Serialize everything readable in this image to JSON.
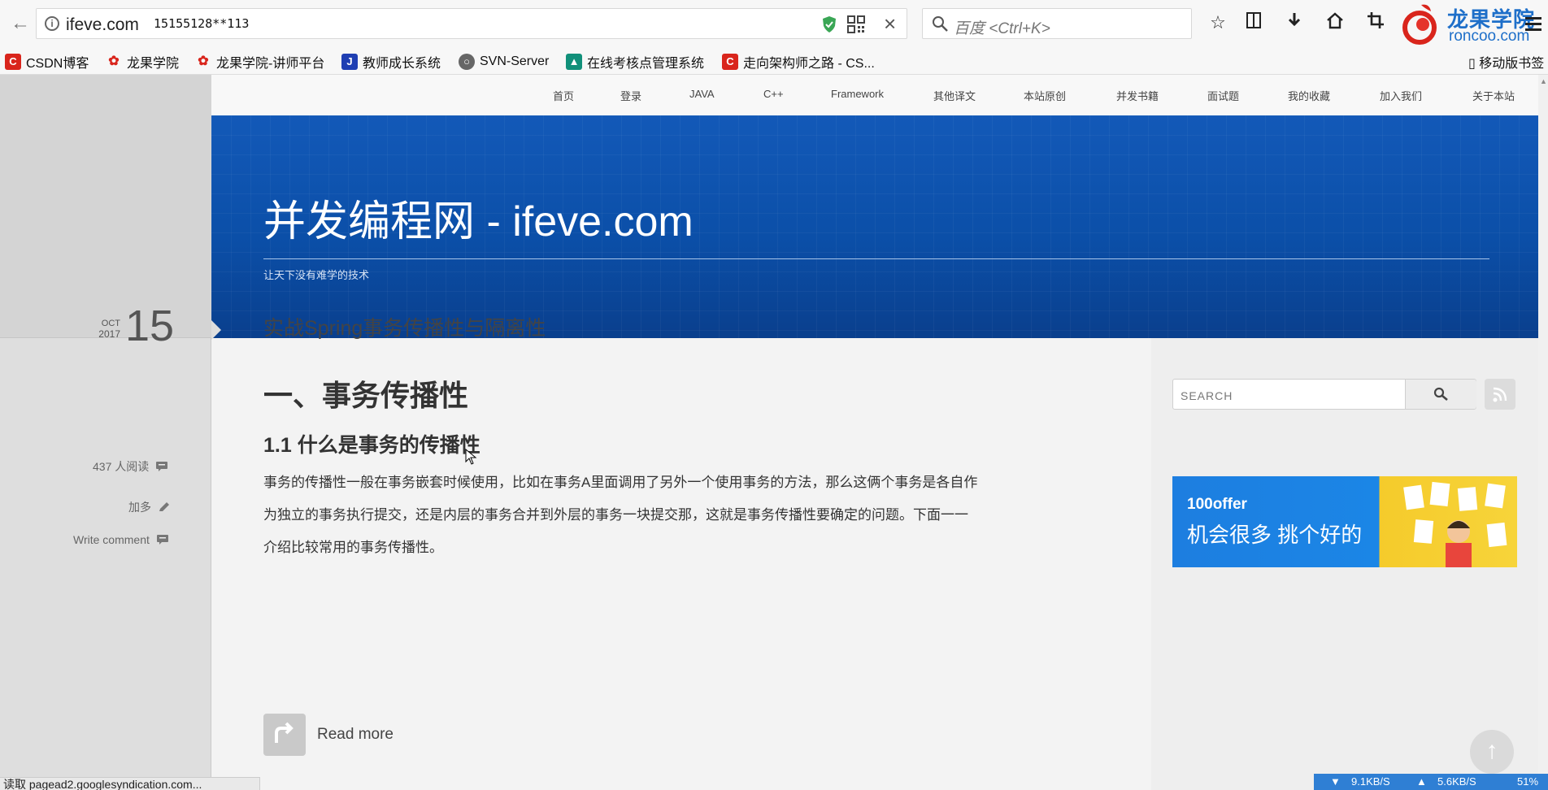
{
  "browser": {
    "url": "ifeve.com",
    "url_overlay": "15155128**113",
    "search_placeholder": "百度 <Ctrl+K>",
    "brand_name": "龙果学院",
    "brand_domain": "roncoo.com"
  },
  "bookmarks": {
    "items": [
      {
        "label": "CSDN博客",
        "icon": "csdn-icon",
        "color": "#d9251c"
      },
      {
        "label": "龙果学院",
        "icon": "roncoo-icon",
        "color": "#d9251c"
      },
      {
        "label": "龙果学院-讲师平台",
        "icon": "roncoo-icon",
        "color": "#d9251c"
      },
      {
        "label": "教师成长系统",
        "icon": "teacher-icon",
        "color": "#1f3fb3"
      },
      {
        "label": "SVN-Server",
        "icon": "globe-icon",
        "color": "#555555"
      },
      {
        "label": "在线考核点管理系统",
        "icon": "exam-icon",
        "color": "#11907a"
      },
      {
        "label": "走向架构师之路 - CS...",
        "icon": "csdn-icon",
        "color": "#d9251c"
      }
    ],
    "mobile_label": "移动版书签"
  },
  "nav": {
    "items": [
      "首页",
      "登录",
      "JAVA",
      "C++",
      "Framework",
      "其他译文",
      "本站原创",
      "并发书籍",
      "面试题",
      "我的收藏",
      "加入我们",
      "关于本站"
    ]
  },
  "site": {
    "title": "并发编程网 - ifeve.com",
    "tagline": "让天下没有难学的技术"
  },
  "post": {
    "month": "OCT",
    "year": "2017",
    "day": "15",
    "reads": "437 人阅读",
    "like": "加多",
    "comment": "Write comment",
    "title": "实战Spring事务传播性与隔离性",
    "h1": "一、事务传播性",
    "h2": "1.1 什么是事务的传播性",
    "paragraph": [
      "事务的传播性一般在事务嵌套时候使用，比如在事务A里面调用了另外一个使用事务的方法，那么这俩个事务是各自作",
      "为独立的事务执行提交，还是内层的事务合并到外层的事务一块提交那，这就是事务传播性要确定的问题。下面一一",
      "介绍比较常用的事务传播性。"
    ],
    "read_more": "Read more"
  },
  "sidebar": {
    "search_placeholder": "SEARCH",
    "ad_logo": "100offer",
    "ad_slogan": "机会很多 挑个好的"
  },
  "status": {
    "text": "读取 pagead2.googlesyndication.com...",
    "down": "9.1KB/S",
    "up": "5.6KB/S",
    "percent": "51%"
  },
  "colors": {
    "banner": "#0b4fa8",
    "brand": "#1e6fc9",
    "ad_blue": "#1b86e6",
    "ad_yellow": "#f7d43a"
  }
}
